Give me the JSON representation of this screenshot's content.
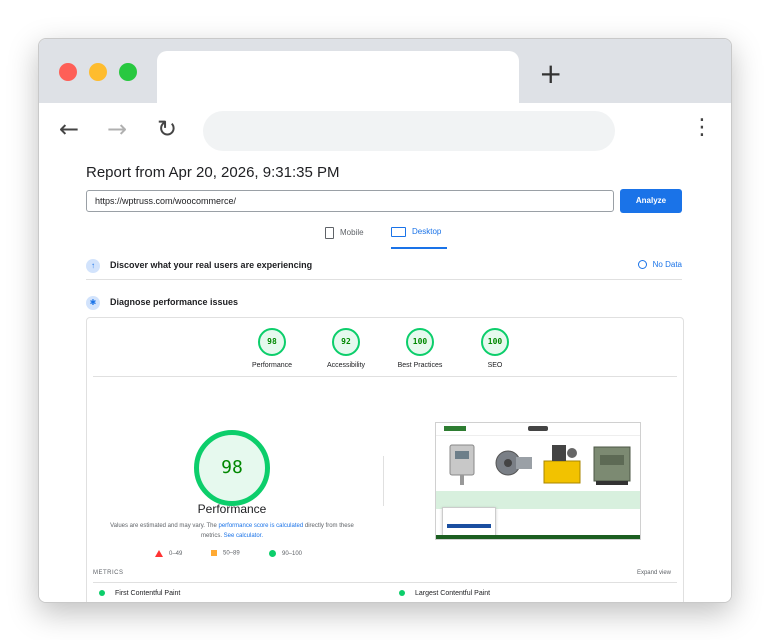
{
  "browser": {
    "new_tab_glyph": "+",
    "back_glyph": "←",
    "forward_glyph": "→",
    "reload_glyph": "↻",
    "menu_glyph": "⋮"
  },
  "report": {
    "title": "Report from Apr 20, 2026, 9:31:35 PM",
    "url_value": "https://wptruss.com/woocommerce/",
    "analyze_label": "Analyze"
  },
  "device_tabs": {
    "mobile": "Mobile",
    "desktop": "Desktop",
    "selected": "Desktop"
  },
  "sections": {
    "real_users": "Discover what your real users are experiencing",
    "no_data": "No Data",
    "diagnose": "Diagnose performance issues"
  },
  "scores": [
    {
      "value": "98",
      "label": "Performance"
    },
    {
      "value": "92",
      "label": "Accessibility"
    },
    {
      "value": "100",
      "label": "Best Practices"
    },
    {
      "value": "100",
      "label": "SEO"
    }
  ],
  "main_score": {
    "value": "98",
    "label": "Performance",
    "note_prefix": "Values are estimated and may vary. The ",
    "note_link1": "performance score is calculated",
    "note_mid": " directly from these metrics. ",
    "note_link2": "See calculator."
  },
  "legend": {
    "fail": "0–49",
    "average": "50–89",
    "pass": "90–100"
  },
  "metrics": {
    "header": "METRICS",
    "expand": "Expand view",
    "items": [
      "First Contentful Paint",
      "Largest Contentful Paint"
    ]
  },
  "colors": {
    "pass": "#0cce6b",
    "average": "#ffaa33",
    "fail": "#ff3333",
    "accent": "#1a73e8"
  }
}
